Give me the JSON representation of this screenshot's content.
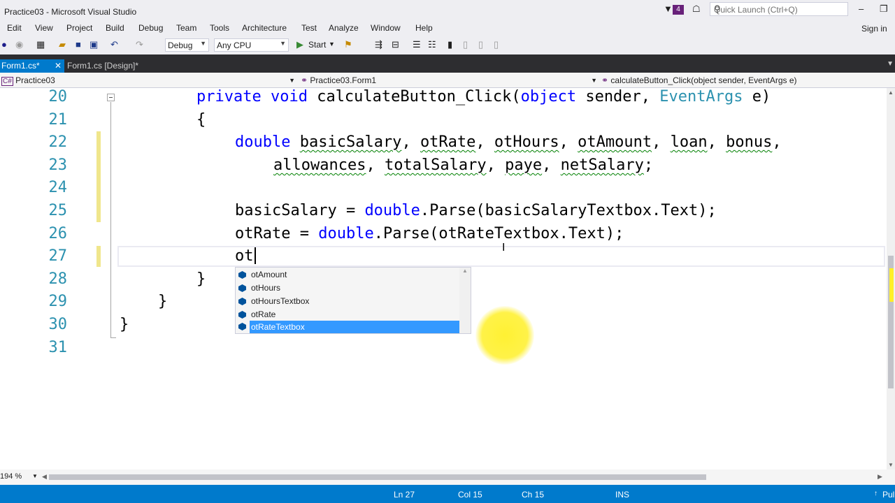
{
  "window": {
    "title": "Practice03 - Microsoft Visual Studio",
    "notification_count": "4",
    "quick_launch_placeholder": "Quick Launch (Ctrl+Q)",
    "sign_in": "Sign in"
  },
  "menu": [
    "Edit",
    "View",
    "Project",
    "Build",
    "Debug",
    "Team",
    "Tools",
    "Architecture",
    "Test",
    "Analyze",
    "Window",
    "Help"
  ],
  "toolbar": {
    "configuration": "Debug",
    "platform": "Any CPU",
    "start_label": "Start"
  },
  "tabs": [
    {
      "label": "Form1.cs*",
      "active": true
    },
    {
      "label": "Form1.cs [Design]*",
      "active": false
    }
  ],
  "navbar": {
    "project": "Practice03",
    "class": "Practice03.Form1",
    "member": "calculateButton_Click(object sender, EventArgs e)"
  },
  "editor": {
    "line_numbers": [
      "20",
      "21",
      "22",
      "23",
      "24",
      "25",
      "26",
      "27",
      "28",
      "29",
      "30",
      "31"
    ],
    "current_line_prefix": "ot"
  },
  "intellisense": [
    {
      "label": "otAmount",
      "selected": false
    },
    {
      "label": "otHours",
      "selected": false
    },
    {
      "label": "otHoursTextbox",
      "selected": false
    },
    {
      "label": "otRate",
      "selected": false
    },
    {
      "label": "otRateTextbox",
      "selected": true
    }
  ],
  "zoom": "194 %",
  "status": {
    "line": "Ln 27",
    "col": "Col 15",
    "ch": "Ch 15",
    "mode": "INS",
    "publish": "Pul"
  },
  "colors": {
    "accent": "#007acc",
    "keyword": "#0000ff",
    "type": "#2b91af",
    "squiggle": "#008000",
    "highlight": "#ffef28"
  }
}
